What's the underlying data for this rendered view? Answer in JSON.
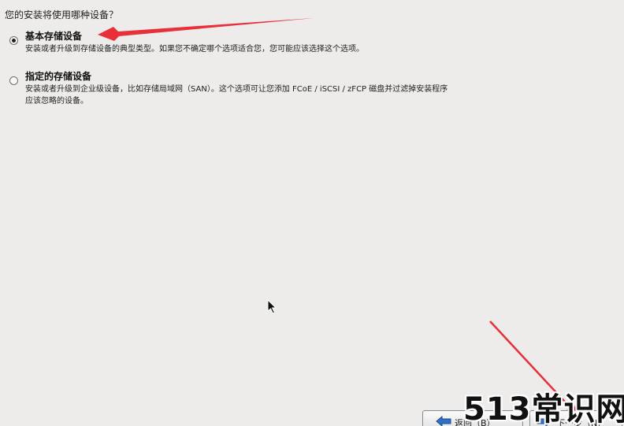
{
  "question": "您的安装将使用哪种设备？",
  "options": [
    {
      "title": "基本存储设备",
      "desc_line1": "安装或者升级到存储设备的典型类型。如果您不确定哪个选项适合您，您可能应该选择这个选项。",
      "desc_line2": "",
      "selected": true
    },
    {
      "title": "指定的存储设备",
      "desc_line1": "安装或者升级到企业级设备，比如存储局域网（SAN）。这个选项可让您添加 FCoE / iSCSI / zFCP 磁盘并过滤掉安装程序",
      "desc_line2": "应该忽略的设备。",
      "selected": false
    }
  ],
  "buttons": {
    "back_label": "返回（B）",
    "next_label": "下一步（N）"
  },
  "watermark": "513常识网",
  "icons": {
    "back": "left-arrow-icon",
    "next": "right-arrow-icon",
    "cursor": "mouse-pointer-icon"
  },
  "colors": {
    "background": "#edeceb",
    "annotation_arrow": "#e8303a",
    "button_arrow": "#2f6fc4"
  }
}
